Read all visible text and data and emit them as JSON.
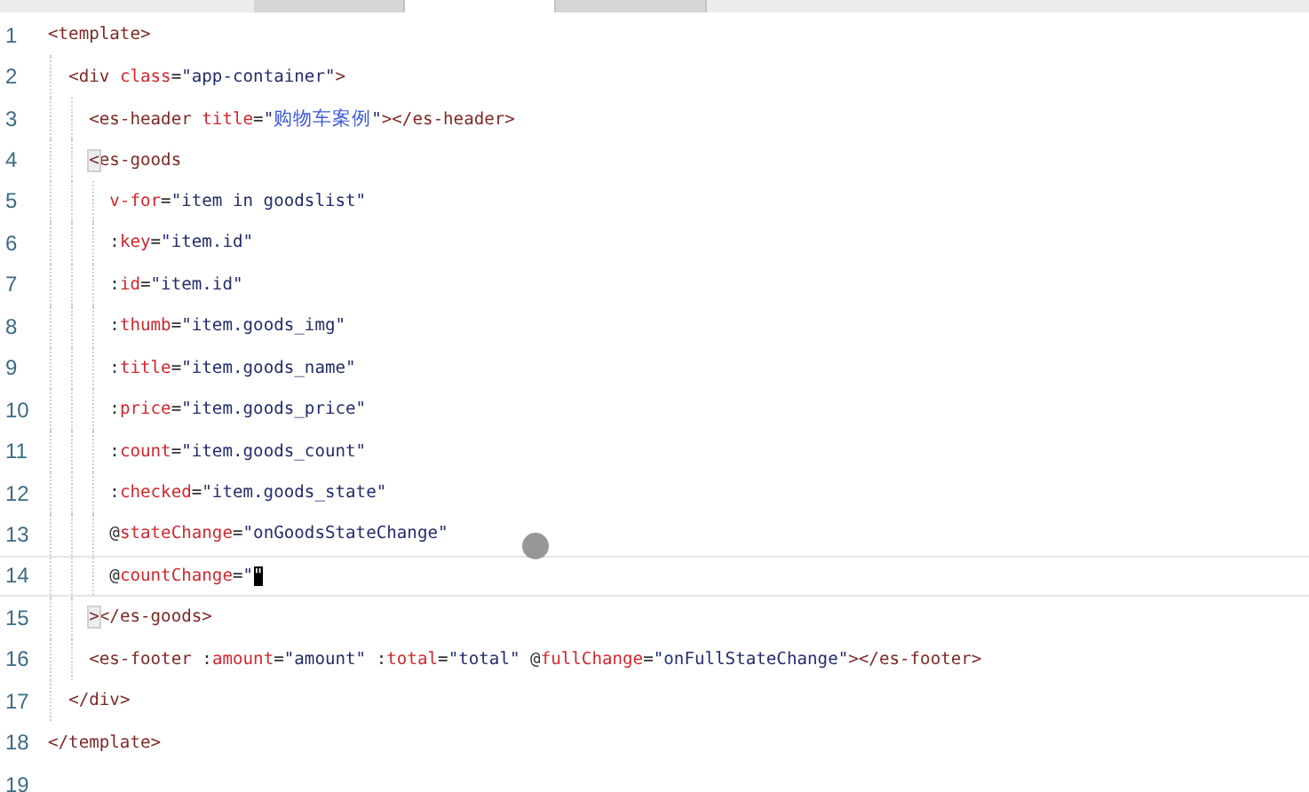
{
  "tabs": [
    {
      "selected": false
    },
    {
      "selected": true
    },
    {
      "selected": false
    }
  ],
  "lines": [
    {
      "number": "1",
      "current": false,
      "tokens": [
        {
          "kind": "tag",
          "t": "<template>"
        }
      ]
    },
    {
      "number": "2",
      "current": false,
      "tokens": [
        {
          "kind": "tag",
          "t": "  <div"
        },
        {
          "kind": "attr",
          "t": " class"
        },
        {
          "kind": "punct",
          "t": "="
        },
        {
          "kind": "string",
          "t": "\"app-container\""
        },
        {
          "kind": "tag",
          "t": ">"
        }
      ]
    },
    {
      "number": "3",
      "current": false,
      "tokens": [
        {
          "kind": "tag",
          "t": "    <es-header"
        },
        {
          "kind": "attr",
          "t": " title"
        },
        {
          "kind": "punct",
          "t": "="
        },
        {
          "kind": "string",
          "t": "\""
        },
        {
          "kind": "cjk",
          "t": "购物车案例"
        },
        {
          "kind": "string",
          "t": "\""
        },
        {
          "kind": "tag",
          "t": "></es-header>"
        }
      ]
    },
    {
      "number": "4",
      "current": false,
      "tokens": [
        {
          "kind": "match",
          "t": "    <"
        },
        {
          "kind": "tag",
          "t": "es-goods"
        }
      ]
    },
    {
      "number": "5",
      "current": false,
      "tokens": [
        {
          "kind": "attr",
          "t": "      v-for"
        },
        {
          "kind": "punct",
          "t": "="
        },
        {
          "kind": "string",
          "t": "\"item in goodslist\""
        }
      ]
    },
    {
      "number": "6",
      "current": false,
      "tokens": [
        {
          "kind": "punct",
          "t": "      :"
        },
        {
          "kind": "attr",
          "t": "key"
        },
        {
          "kind": "punct",
          "t": "="
        },
        {
          "kind": "string",
          "t": "\"item.id\""
        }
      ]
    },
    {
      "number": "7",
      "current": false,
      "tokens": [
        {
          "kind": "punct",
          "t": "      :"
        },
        {
          "kind": "attr",
          "t": "id"
        },
        {
          "kind": "punct",
          "t": "="
        },
        {
          "kind": "string",
          "t": "\"item.id\""
        }
      ]
    },
    {
      "number": "8",
      "current": false,
      "tokens": [
        {
          "kind": "punct",
          "t": "      :"
        },
        {
          "kind": "attr",
          "t": "thumb"
        },
        {
          "kind": "punct",
          "t": "="
        },
        {
          "kind": "string",
          "t": "\"item.goods_img\""
        }
      ]
    },
    {
      "number": "9",
      "current": false,
      "tokens": [
        {
          "kind": "punct",
          "t": "      :"
        },
        {
          "kind": "attr",
          "t": "title"
        },
        {
          "kind": "punct",
          "t": "="
        },
        {
          "kind": "string",
          "t": "\"item.goods_name\""
        }
      ]
    },
    {
      "number": "10",
      "current": false,
      "tokens": [
        {
          "kind": "punct",
          "t": "      :"
        },
        {
          "kind": "attr",
          "t": "price"
        },
        {
          "kind": "punct",
          "t": "="
        },
        {
          "kind": "string",
          "t": "\"item.goods_price\""
        }
      ]
    },
    {
      "number": "11",
      "current": false,
      "tokens": [
        {
          "kind": "punct",
          "t": "      :"
        },
        {
          "kind": "attr",
          "t": "count"
        },
        {
          "kind": "punct",
          "t": "="
        },
        {
          "kind": "string",
          "t": "\"item.goods_count\""
        }
      ]
    },
    {
      "number": "12",
      "current": false,
      "tokens": [
        {
          "kind": "punct",
          "t": "      :"
        },
        {
          "kind": "attr",
          "t": "checked"
        },
        {
          "kind": "punct",
          "t": "="
        },
        {
          "kind": "string",
          "t": "\"item.goods_state\""
        }
      ]
    },
    {
      "number": "13",
      "current": false,
      "tokens": [
        {
          "kind": "punct",
          "t": "      @"
        },
        {
          "kind": "attr",
          "t": "stateChange"
        },
        {
          "kind": "punct",
          "t": "="
        },
        {
          "kind": "string",
          "t": "\"onGoodsStateChange\""
        }
      ]
    },
    {
      "number": "14",
      "current": true,
      "tokens": [
        {
          "kind": "punct",
          "t": "      @"
        },
        {
          "kind": "attr",
          "t": "countChange"
        },
        {
          "kind": "punct",
          "t": "="
        },
        {
          "kind": "string",
          "t": "\""
        },
        {
          "kind": "cursor",
          "t": "\""
        }
      ]
    },
    {
      "number": "15",
      "current": false,
      "tokens": [
        {
          "kind": "match",
          "t": "    >"
        },
        {
          "kind": "tag",
          "t": "</es-goods>"
        }
      ]
    },
    {
      "number": "16",
      "current": false,
      "tokens": [
        {
          "kind": "tag",
          "t": "    <es-footer"
        },
        {
          "kind": "punct",
          "t": " :"
        },
        {
          "kind": "attr",
          "t": "amount"
        },
        {
          "kind": "punct",
          "t": "="
        },
        {
          "kind": "string",
          "t": "\"amount\""
        },
        {
          "kind": "punct",
          "t": " :"
        },
        {
          "kind": "attr",
          "t": "total"
        },
        {
          "kind": "punct",
          "t": "="
        },
        {
          "kind": "string",
          "t": "\"total\""
        },
        {
          "kind": "punct",
          "t": " @"
        },
        {
          "kind": "attr",
          "t": "fullChange"
        },
        {
          "kind": "punct",
          "t": "="
        },
        {
          "kind": "string",
          "t": "\"onFullStateChange\""
        },
        {
          "kind": "tag",
          "t": "></es-footer>"
        }
      ]
    },
    {
      "number": "17",
      "current": false,
      "tokens": [
        {
          "kind": "tag",
          "t": "  </div>"
        }
      ]
    },
    {
      "number": "18",
      "current": false,
      "tokens": [
        {
          "kind": "tag",
          "t": "</template>"
        }
      ]
    },
    {
      "number": "19",
      "current": false
    }
  ]
}
